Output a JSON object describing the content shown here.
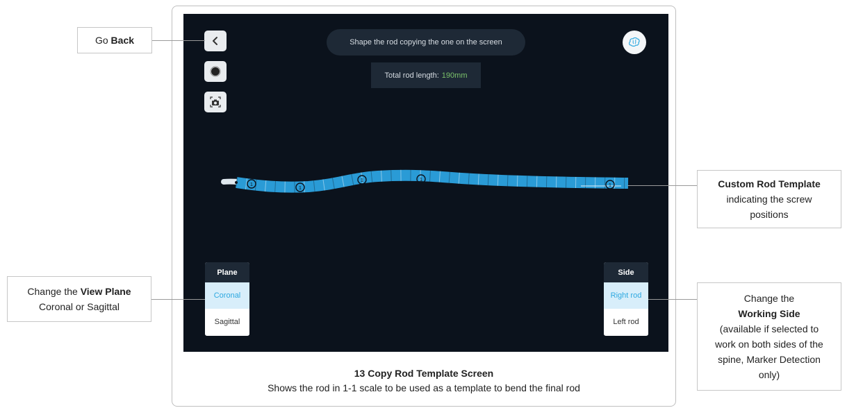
{
  "callouts": {
    "go_back": {
      "prefix": "Go ",
      "bold": "Back"
    },
    "custom_rod": {
      "bold": "Custom Rod Template",
      "line2": "indicating the screw",
      "line3": "positions"
    },
    "view_plane": {
      "prefix": "Change the ",
      "bold": "View Plane",
      "line2": "Coronal or Sagittal"
    },
    "working_side": {
      "line1": "Change the",
      "bold": "Working Side",
      "line3": "(available if selected to",
      "line4": "work on both sides of the",
      "line5": "spine, Marker Detection",
      "line6": "only)"
    }
  },
  "screen": {
    "instruction": "Shape the rod copying the one on the screen",
    "length_label": "Total rod length:",
    "length_value": "190mm",
    "plane_panel": {
      "header": "Plane",
      "options": [
        "Coronal",
        "Sagittal"
      ],
      "selected": "Coronal"
    },
    "side_panel": {
      "header": "Side",
      "options": [
        "Right rod",
        "Left rod"
      ],
      "selected": "Right rod"
    },
    "icons": [
      "back-chevron-icon",
      "record-icon",
      "camera-icon",
      "brain-icon"
    ]
  },
  "caption": {
    "title": "13 Copy Rod Template Screen",
    "subtitle": "Shows the rod in 1-1 scale to be used as a template to bend the final rod"
  },
  "colors": {
    "screen_bg": "#0b121c",
    "rod": "#2a9bd6",
    "accent_green": "#7cc36b",
    "selected": "#2da8e0"
  }
}
